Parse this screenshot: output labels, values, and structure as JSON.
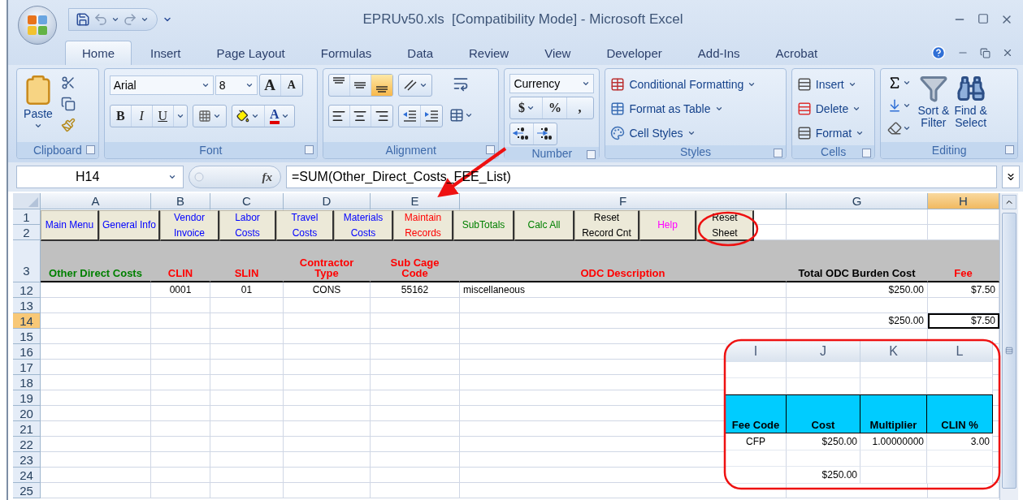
{
  "window": {
    "title": "EPRUv50.xls  [Compatibility Mode] - Microsoft Excel"
  },
  "ribbon_tabs": [
    {
      "label": "Home",
      "selected": true
    },
    {
      "label": "Insert",
      "selected": false
    },
    {
      "label": "Page Layout",
      "selected": false
    },
    {
      "label": "Formulas",
      "selected": false
    },
    {
      "label": "Data",
      "selected": false
    },
    {
      "label": "Review",
      "selected": false
    },
    {
      "label": "View",
      "selected": false
    },
    {
      "label": "Developer",
      "selected": false
    },
    {
      "label": "Add-Ins",
      "selected": false
    },
    {
      "label": "Acrobat",
      "selected": false
    }
  ],
  "ribbon_groups": [
    {
      "kind": "clipboard",
      "label": "Clipboard",
      "paste": "Paste"
    },
    {
      "kind": "font",
      "label": "Font",
      "font_name": "Arial",
      "font_size": "8",
      "size_buttons": [
        "A",
        "A"
      ],
      "style_buttons": [
        "B",
        "I",
        "U"
      ],
      "color_button": "A"
    },
    {
      "kind": "alignment",
      "label": "Alignment",
      "vertical": [
        {
          "selected": false
        },
        {
          "selected": false
        },
        {
          "selected": true
        }
      ]
    },
    {
      "kind": "number",
      "label": "Number",
      "format": "Currency",
      "symbol_buttons": [
        "$",
        "%",
        ","
      ]
    },
    {
      "kind": "styles",
      "label": "Styles",
      "commands": [
        "Conditional Formatting",
        "Format as Table",
        "Cell Styles"
      ]
    },
    {
      "kind": "cells",
      "label": "Cells",
      "commands": [
        "Insert",
        "Delete",
        "Format"
      ]
    },
    {
      "kind": "editing",
      "label": "Editing",
      "commands": [
        "Sort &\nFilter",
        "Find &\nSelect"
      ]
    }
  ],
  "formula_bar": {
    "name_box": "H14",
    "function_label": "fx",
    "formula": "=SUM(Other_Direct_Costs_FEE_List)"
  },
  "sheet": {
    "columns": [
      {
        "label": "A",
        "selected": false
      },
      {
        "label": "B",
        "selected": false
      },
      {
        "label": "C",
        "selected": false
      },
      {
        "label": "D",
        "selected": false
      },
      {
        "label": "E",
        "selected": false
      },
      {
        "label": "F",
        "selected": false
      },
      {
        "label": "G",
        "selected": false
      },
      {
        "label": "H",
        "selected": true
      }
    ],
    "buttons": [
      {
        "label": "Main Menu",
        "color": "#0000ff"
      },
      {
        "label": "General Info",
        "color": "#0000ff"
      },
      {
        "label": "Vendor\nInvoice",
        "color": "#0000ff"
      },
      {
        "label": "Labor\nCosts",
        "color": "#0000ff"
      },
      {
        "label": "Travel\nCosts",
        "color": "#0000ff"
      },
      {
        "label": "Materials\nCosts",
        "color": "#0000ff"
      },
      {
        "label": "Maintain\nRecords",
        "color": "#ff0000"
      },
      {
        "label": "SubTotals",
        "color": "#008000"
      },
      {
        "label": "Calc All",
        "color": "#008000"
      },
      {
        "label": "Reset\nRecord Cnt",
        "color": "#000000"
      },
      {
        "label": "Help",
        "color": "#ff00ff"
      },
      {
        "label": "Reset\nSheet",
        "color": "#000000"
      }
    ],
    "rows": [
      {
        "number": "1",
        "kind": "data",
        "selected": false
      },
      {
        "number": "2",
        "kind": "data",
        "selected": false
      },
      {
        "number": "3",
        "kind": "header",
        "selected": false,
        "cells": {
          "A": {
            "text": "Other Direct Costs",
            "color": "#008000"
          },
          "B": {
            "text": "CLIN",
            "color": "#ff0000"
          },
          "C": {
            "text": "SLIN",
            "color": "#ff0000"
          },
          "D": {
            "text": "Contractor\nType",
            "color": "#ff0000"
          },
          "E": {
            "text": "Sub Cage\nCode",
            "color": "#ff0000"
          },
          "F": {
            "text": "ODC Description",
            "color": "#ff0000"
          },
          "G": {
            "text": "Total ODC Burden Cost",
            "color": "#000000"
          },
          "H": {
            "text": "Fee",
            "color": "#ff0000"
          }
        }
      },
      {
        "number": "12",
        "kind": "data",
        "selected": false,
        "cells": {
          "B": {
            "text": "0001",
            "selected": false
          },
          "C": {
            "text": "01",
            "selected": false
          },
          "D": {
            "text": "CONS",
            "selected": false
          },
          "E": {
            "text": "55162",
            "selected": false
          },
          "F": {
            "text": "miscellaneous",
            "selected": false
          },
          "G": {
            "text": "$250.00",
            "selected": false
          },
          "H": {
            "text": "$7.50",
            "selected": false
          }
        }
      },
      {
        "number": "13",
        "kind": "data",
        "selected": false
      },
      {
        "number": "14",
        "kind": "data",
        "selected": true,
        "cells": {
          "G": {
            "text": "$250.00",
            "selected": false
          },
          "H": {
            "text": "$7.50",
            "selected": true
          }
        }
      },
      {
        "number": "15",
        "kind": "data",
        "selected": false
      },
      {
        "number": "16",
        "kind": "data",
        "selected": false
      },
      {
        "number": "17",
        "kind": "data",
        "selected": false
      },
      {
        "number": "18",
        "kind": "data",
        "selected": false
      },
      {
        "number": "19",
        "kind": "data",
        "selected": false
      },
      {
        "number": "20",
        "kind": "data",
        "selected": false
      },
      {
        "number": "21",
        "kind": "data",
        "selected": false
      },
      {
        "number": "22",
        "kind": "data",
        "selected": false
      },
      {
        "number": "23",
        "kind": "data",
        "selected": false
      },
      {
        "number": "24",
        "kind": "data",
        "selected": false
      },
      {
        "number": "25",
        "kind": "data",
        "selected": false
      }
    ]
  },
  "inset": {
    "columns": [
      "I",
      "J",
      "K",
      "L"
    ],
    "rows": [
      {
        "kind": "blank"
      },
      {
        "kind": "blank"
      },
      {
        "kind": "header",
        "cells": {
          "I": "Fee Code",
          "J": "Cost",
          "K": "Multiplier",
          "L": "CLIN %"
        }
      },
      {
        "kind": "data",
        "cells": {
          "I": "CFP",
          "J": "$250.00",
          "K": "1.00000000",
          "L": "3.00"
        }
      },
      {
        "kind": "blank"
      },
      {
        "kind": "data",
        "cells": {
          "J": "$250.00"
        }
      }
    ]
  }
}
